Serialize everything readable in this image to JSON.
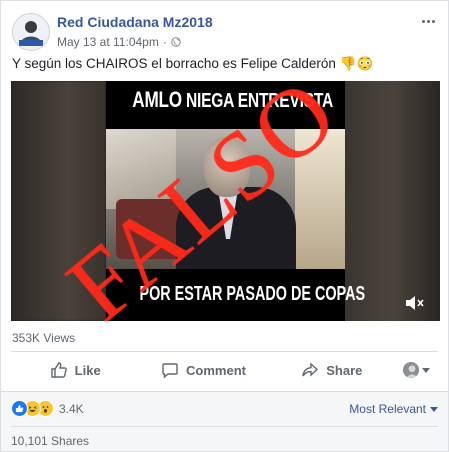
{
  "post": {
    "author": "Red Ciudadana Mz2018",
    "timestamp": "May 13 at 11:04pm",
    "separator": "·",
    "text": "Y según los CHAIROS el borracho es Felipe Calderón",
    "emojis": "👎😳"
  },
  "video": {
    "caption_top_a": "AMLO",
    "caption_top_b": " NIEGA ENTREVISTA",
    "caption_bottom": "POR ESTAR PASADO DE COPAS",
    "stamp": "FALSO",
    "muted": true
  },
  "stats": {
    "views": "353K Views",
    "reaction_count": "3.4K",
    "shares": "10,101 Shares",
    "sort_label": "Most Relevant"
  },
  "actions": {
    "like": "Like",
    "comment": "Comment",
    "share": "Share"
  },
  "icons": {
    "more": "more-options-icon",
    "privacy": "globe-icon",
    "like": "thumbs-up-icon",
    "comment": "speech-bubble-icon",
    "share": "share-arrow-icon",
    "mute": "speaker-muted-icon"
  },
  "colors": {
    "brand_link": "#385898",
    "like_blue": "#1877f2",
    "stamp_red": "#ff2a1a"
  }
}
